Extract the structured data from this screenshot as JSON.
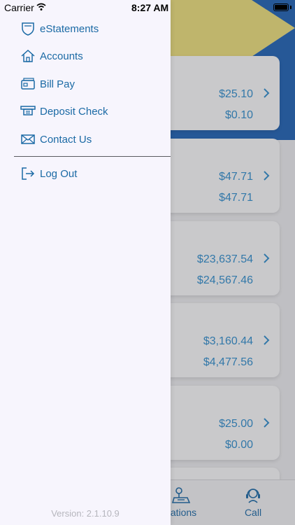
{
  "status_bar": {
    "carrier": "Carrier",
    "time": "8:27 AM"
  },
  "drawer": {
    "items": [
      {
        "label": "eStatements",
        "icon": "shield-icon"
      },
      {
        "label": "Accounts",
        "icon": "home-icon"
      },
      {
        "label": "Bill Pay",
        "icon": "card-icon"
      },
      {
        "label": "Deposit Check",
        "icon": "check-deposit-icon"
      },
      {
        "label": "Contact Us",
        "icon": "envelope-icon"
      }
    ],
    "logout_label": "Log Out",
    "version": "Version: 2.1.10.9"
  },
  "accounts": [
    {
      "value1": "$25.10",
      "value2": "$0.10"
    },
    {
      "value1": "$47.71",
      "value2": "$47.71"
    },
    {
      "value1": "$23,637.54",
      "value2": "$24,567.46"
    },
    {
      "value1": "$3,160.44",
      "value2": "$4,477.56"
    },
    {
      "value1": "$25.00",
      "value2": "$0.00"
    }
  ],
  "tabbar": {
    "locations_label": "cations",
    "call_label": "Call"
  },
  "colors": {
    "accent": "#1b6aa5",
    "amount_blue": "#2f8fd0",
    "hero_blue": "#1e63b8",
    "hero_yellow": "#f2e37c",
    "drawer_bg": "#f7f5fd"
  }
}
